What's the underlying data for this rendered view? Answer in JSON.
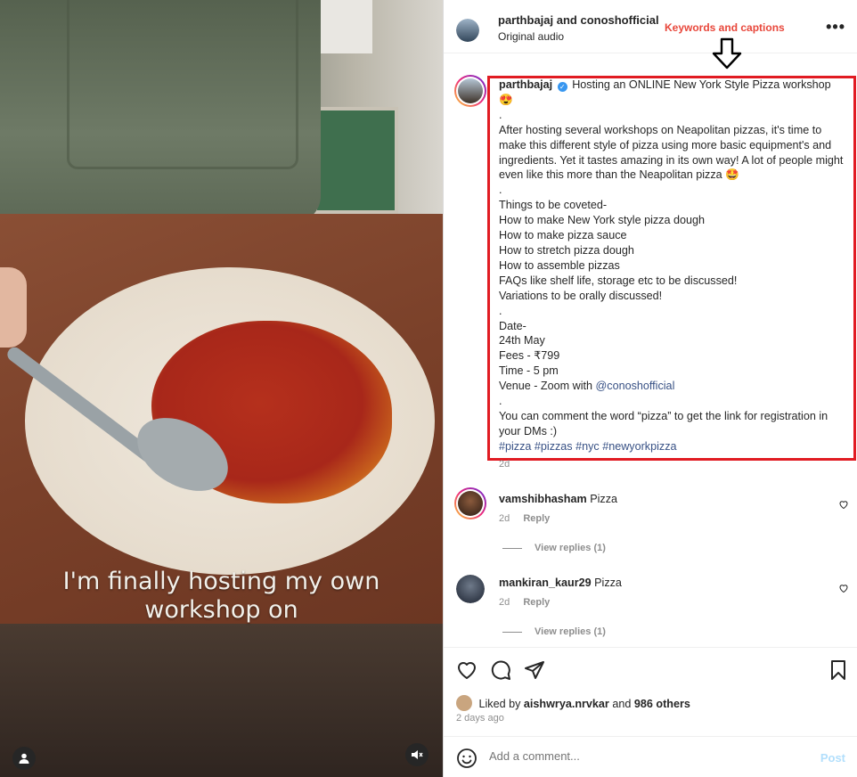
{
  "video": {
    "caption_line1": "I'm finally hosting my own",
    "caption_line2": "workshop on",
    "user_icon": "user-icon",
    "mute_icon": "muted-speaker-icon"
  },
  "header": {
    "names": "parthbajaj and conoshofficial",
    "audio": "Original audio",
    "more_icon": "more-options-icon"
  },
  "annotation": {
    "label": "Keywords and captions",
    "arrow_icon": "down-arrow-icon",
    "color": "#e11b22"
  },
  "post": {
    "username": "parthbajaj",
    "verified_icon": "verified-badge-icon",
    "lines": [
      "Hosting an ONLINE New York Style Pizza workshop",
      "😍",
      ".",
      "After hosting several workshops on Neapolitan pizzas, it's time to make this different style of pizza using more basic equipment's and ingredients. Yet it tastes amazing in its own way! A lot of people might even like this more than the Neapolitan pizza 🤩",
      ".",
      "Things to be coveted-",
      "How to make New York style pizza dough",
      "How to make pizza sauce",
      "How to stretch pizza dough",
      "How to assemble pizzas",
      "FAQs like shelf life, storage etc to be discussed!",
      "Variations to be orally discussed!",
      ".",
      "Date-",
      "24th May",
      "Fees - ₹799",
      "Time - 5 pm",
      "Venue - Zoom with",
      ".",
      "You can comment the word “pizza” to get the link for registration in your DMs :)"
    ],
    "venue_mention": "@conoshofficial",
    "hashtags": "#pizza #pizzas #nyc #newyorkpizza",
    "time": "2d"
  },
  "comments": [
    {
      "username": "vamshibhasham",
      "text": "Pizza",
      "time": "2d",
      "reply": "Reply",
      "view_replies": "View replies (1)"
    },
    {
      "username": "mankiran_kaur29",
      "text": "Pizza",
      "time": "2d",
      "reply": "Reply",
      "view_replies": "View replies (1)"
    }
  ],
  "actions": {
    "icons": [
      "heart-icon",
      "comment-icon",
      "share-icon",
      "bookmark-icon"
    ],
    "liked_by_prefix": "Liked by",
    "liked_by_user": "aishwrya.nrvkar",
    "liked_by_and": "and",
    "liked_by_others": "986 others",
    "ago": "2 days ago"
  },
  "add_comment": {
    "placeholder": "Add a comment...",
    "post_label": "Post",
    "emoji_icon": "emoji-icon"
  },
  "colors": {
    "link": "#385185",
    "post_button": "#b2dffc",
    "muted_text": "#8e8e8e"
  }
}
